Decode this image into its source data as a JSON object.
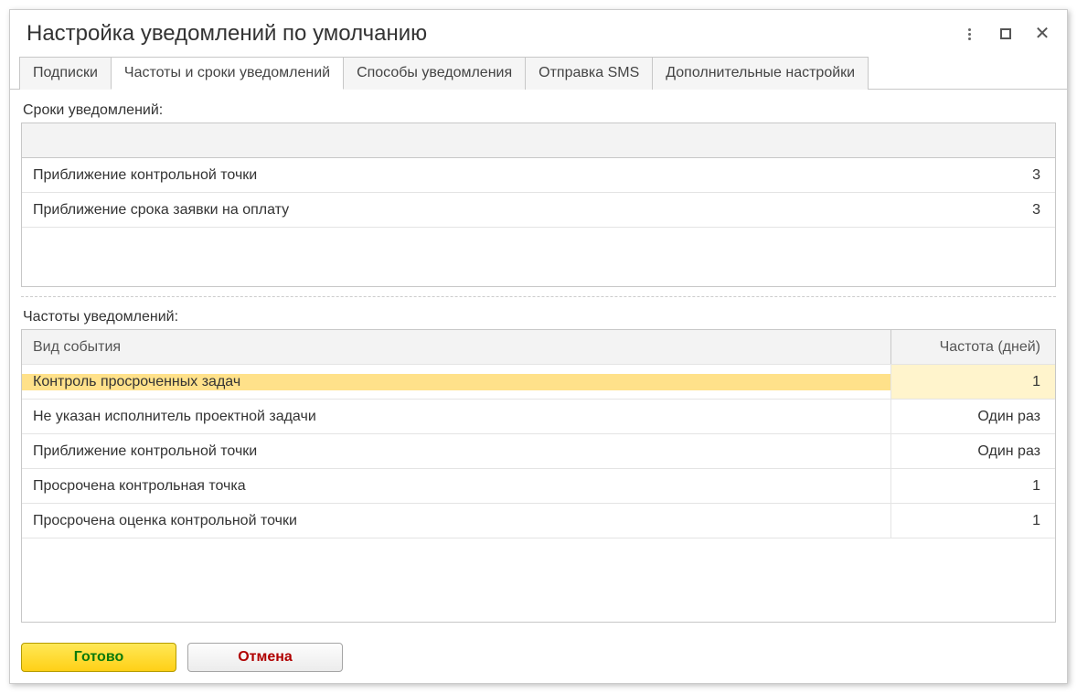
{
  "window": {
    "title": "Настройка уведомлений по умолчанию"
  },
  "tabs": [
    {
      "label": "Подписки"
    },
    {
      "label": "Частоты и сроки уведомлений"
    },
    {
      "label": "Способы уведомления"
    },
    {
      "label": "Отправка SMS"
    },
    {
      "label": "Дополнительные настройки"
    }
  ],
  "section1": {
    "label": "Сроки уведомлений:",
    "rows": [
      {
        "name": "Приближение контрольной точки",
        "value": "3"
      },
      {
        "name": "Приближение срока заявки на оплату",
        "value": "3"
      }
    ]
  },
  "section2": {
    "label": "Частоты уведомлений:",
    "col1": "Вид события",
    "col2": "Частота (дней)",
    "rows": [
      {
        "name": "Контроль просроченных задач",
        "value": "1",
        "selected": true
      },
      {
        "name": "Не указан исполнитель проектной задачи",
        "value": "Один раз"
      },
      {
        "name": "Приближение контрольной точки",
        "value": "Один раз"
      },
      {
        "name": "Просрочена контрольная точка",
        "value": "1"
      },
      {
        "name": "Просрочена оценка контрольной точки",
        "value": "1"
      }
    ]
  },
  "buttons": {
    "ok": "Готово",
    "cancel": "Отмена"
  }
}
